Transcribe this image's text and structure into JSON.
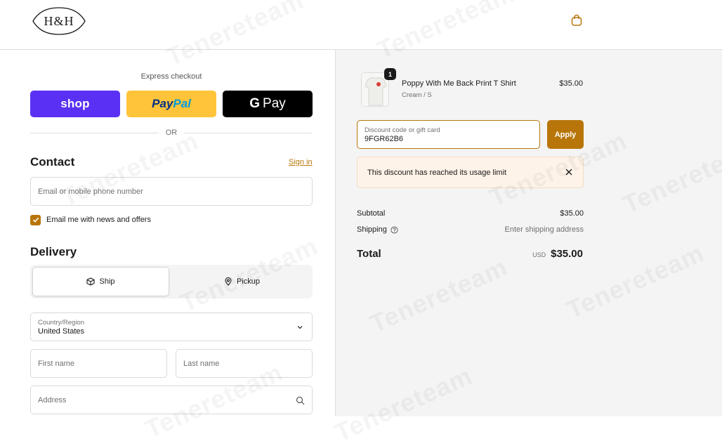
{
  "header": {
    "logo_text": "H&H"
  },
  "express": {
    "title": "Express checkout",
    "shop_label": "shop",
    "paypal_part1": "Pay",
    "paypal_part2": "Pal",
    "gpay_g": "G",
    "gpay_label": "Pay",
    "or_label": "OR"
  },
  "contact": {
    "heading": "Contact",
    "sign_in": "Sign in",
    "email_placeholder": "Email or mobile phone number",
    "newsletter_label": "Email me with news and offers",
    "newsletter_checked": true
  },
  "delivery": {
    "heading": "Delivery",
    "options": [
      {
        "label": "Ship",
        "selected": true
      },
      {
        "label": "Pickup",
        "selected": false
      }
    ],
    "country_label": "Country/Region",
    "country_value": "United States",
    "first_name_placeholder": "First name",
    "last_name_placeholder": "Last name",
    "address_placeholder": "Address"
  },
  "order": {
    "item": {
      "quantity": "1",
      "name": "Poppy With Me Back Print T Shirt",
      "variant": "Cream / S",
      "price": "$35.00"
    },
    "discount_label": "Discount code or gift card",
    "discount_value": "9FGR62B6",
    "apply_label": "Apply",
    "alert_text": "This discount has reached its usage limit",
    "subtotal_label": "Subtotal",
    "subtotal_value": "$35.00",
    "shipping_label": "Shipping",
    "shipping_value": "Enter shipping address",
    "total_label": "Total",
    "total_currency": "USD",
    "total_value": "$35.00"
  },
  "watermark": "Tenereteam",
  "colors": {
    "accent": "#b8760a",
    "shop_purple": "#5a31f4",
    "paypal_yellow": "#ffc439",
    "alert_bg": "#fdf3e8"
  }
}
